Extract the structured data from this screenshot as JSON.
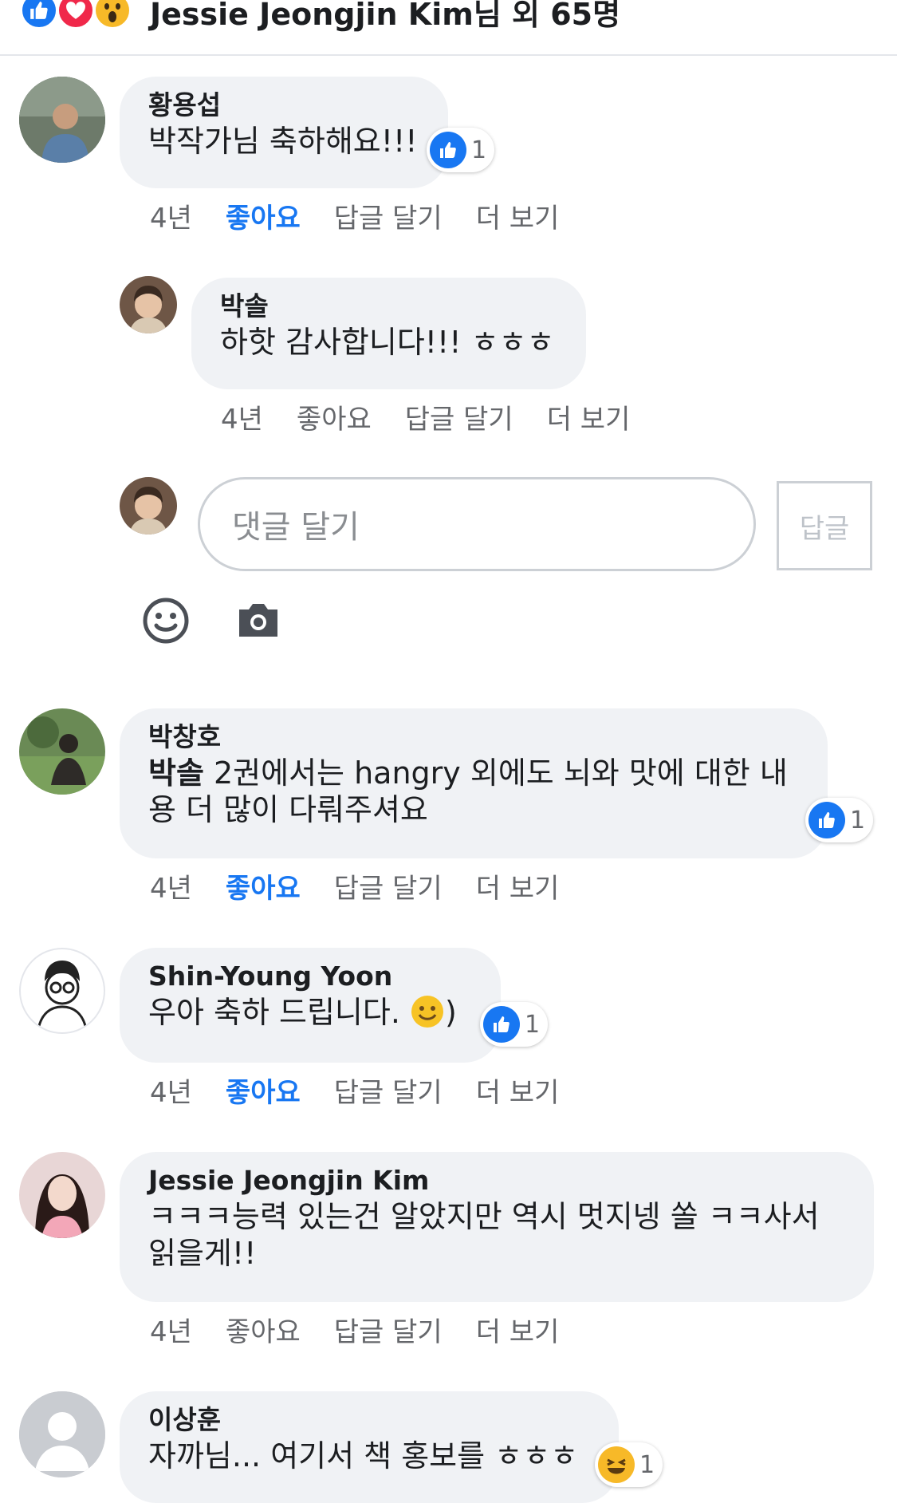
{
  "header": {
    "reactions": [
      "like-icon",
      "love-icon",
      "wow-icon"
    ],
    "text": "Jessie Jeongjin Kim님 외 65명"
  },
  "comments": [
    {
      "author": "황용섭",
      "text": "박작가님 축하해요!!!",
      "time": "4년",
      "like": "좋아요",
      "liked": true,
      "reply": "답글 달기",
      "more": "더 보기",
      "reaction_count": "1"
    },
    {
      "author": "박솔",
      "text": "하핫 감사합니다!!! ㅎㅎㅎ",
      "time": "4년",
      "like": "좋아요",
      "liked": false,
      "reply": "답글 달기",
      "more": "더 보기"
    },
    {
      "author": "박창호",
      "text_bold": "박솔",
      "text": " 2권에서는 hangry 외에도 뇌와 맛에 대한 내용 더 많이 다뤄주셔요",
      "time": "4년",
      "like": "좋아요",
      "liked": true,
      "reply": "답글 달기",
      "more": "더 보기",
      "reaction_count": "1"
    },
    {
      "author": "Shin-Young Yoon",
      "text": "우아 축하 드립니다. ",
      "text_tail": ")",
      "time": "4년",
      "like": "좋아요",
      "liked": true,
      "reply": "답글 달기",
      "more": "더 보기",
      "reaction_count": "1"
    },
    {
      "author": "Jessie Jeongjin Kim",
      "text": "ㅋㅋㅋ능력 있는건 알았지만 역시 멋지넹 쏠 ㅋㅋ사서 읽을게!!",
      "time": "4년",
      "like": "좋아요",
      "liked": false,
      "reply": "답글 달기",
      "more": "더 보기"
    },
    {
      "author": "이상훈",
      "text": "자까님... 여기서 책 홍보를 ㅎㅎㅎ",
      "reaction_count": "1"
    }
  ],
  "reply_box": {
    "placeholder": "댓글 달기",
    "submit_label": "답글"
  },
  "colors": {
    "accent": "#1877f2",
    "bubble": "#f0f2f5",
    "muted": "#65676b"
  }
}
